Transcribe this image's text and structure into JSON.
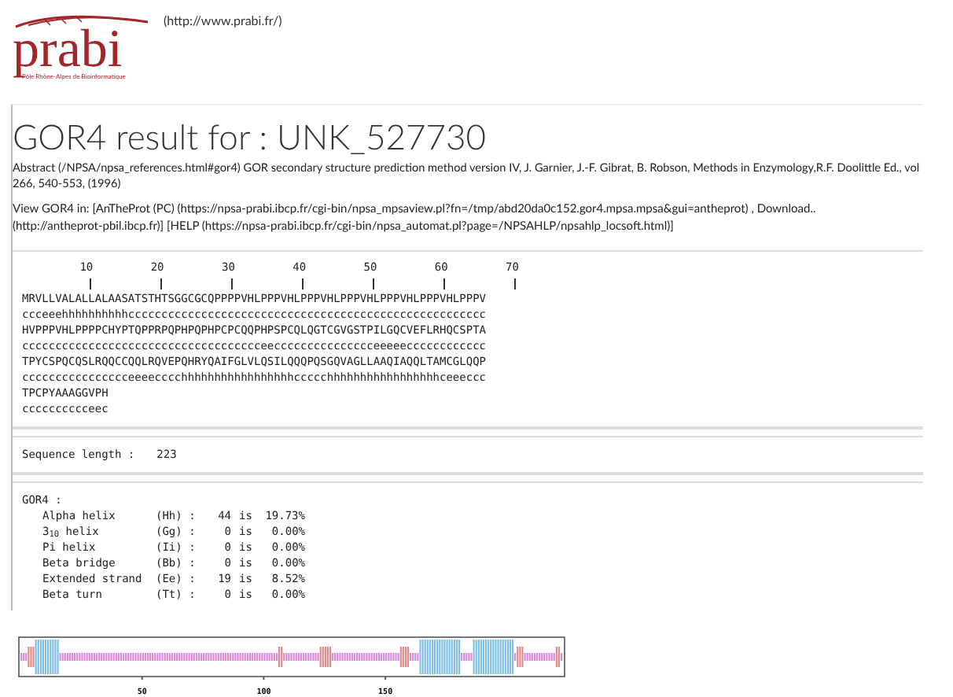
{
  "header": {
    "logo": {
      "name": "prabi",
      "tagline": "Pôle Rhône-Alpes de Bioinformatique"
    },
    "link": "(http://www.prabi.fr/)"
  },
  "title": "GOR4 result for : UNK_527730",
  "abstract": [
    "Abstract (/NPSA/npsa_references.html#gor4) GOR secondary structure prediction method version IV, J. Garnier, J.-F. Gibrat, B. Robson, Methods in Enzymology,R.F. Doolittle Ed., vol",
    "266, 540-553, (1996)"
  ],
  "view_links": "View GOR4 in: [AnTheProt (PC) (https://npsa-prabi.ibcp.fr/cgi-bin/npsa_mpsaview.pl?fn=/tmp/abd20da0c152.gor4.mpsa.mpsa&gui=antheprot) , Download.. (http://antheprot-pbil.ibcp.fr)] [HELP (https://npsa-prabi.ibcp.fr/cgi-bin/npsa_automat.pl?page=/NPSAHLP/npsahlp_locsoft.html)]",
  "ruler": [
    "10",
    "20",
    "30",
    "40",
    "50",
    "60",
    "70"
  ],
  "alignment": [
    {
      "sequence": "MRVLLVALALLALAASATSTHTSGGCGCQPPPPVHLPPPVHLPPPVHLPPPVHLPPPVHLPPPVHLPPPV",
      "structure": "ccceeehhhhhhhhhhcccccccccccccccccccccccccccccccccccccccccccccccccccccc"
    },
    {
      "sequence": "HVPPPVHLPPPPCHYPTQPPRPQPHPQPHPCPCQQPHPSPCQLQGTCGVGSTPILGQCVEFLRHQCSPTA",
      "structure": "cccccccccccccccccccccccccccccccccccceeccccccccccccccceeeeecccccccccccc"
    },
    {
      "sequence": "TPYCSPQCQSLRQQCCQQLRQVEPQHRYQAIFGLVLQSILQQQPQSGQVAGLLAAQIAQQLTAMCGLQQP",
      "structure": "cccccccccccccccceeeecccchhhhhhhhhhhhhhhhhccccchhhhhhhhhhhhhhhhhceeeccc"
    },
    {
      "sequence": "TPCPYAAAGGVPH",
      "structure": "cccccccccceec"
    }
  ],
  "sequence_length": {
    "label": "Sequence length :",
    "value": "223"
  },
  "gor4": {
    "label": "GOR4 :",
    "rows": [
      {
        "name": "Alpha helix",
        "code": "(Hh) :",
        "count": "44",
        "is": "is",
        "percent": "19.73%"
      },
      {
        "name": "3$_{10}$ helix",
        "code": "(Gg) :",
        "count": "0",
        "is": "is",
        "percent": "0.00%"
      },
      {
        "name": "Pi helix",
        "code": "(Ii) :",
        "count": "0",
        "is": "is",
        "percent": "0.00%"
      },
      {
        "name": "Beta bridge",
        "code": "(Bb) :",
        "count": "0",
        "is": "is",
        "percent": "0.00%"
      },
      {
        "name": "Extended strand",
        "code": "(Ee) :",
        "count": "19",
        "is": "is",
        "percent": "8.52%"
      },
      {
        "name": "Beta turn",
        "code": "(Tt) :",
        "count": "0",
        "is": "is",
        "percent": "0.00%"
      }
    ]
  },
  "plot": {
    "ticks": [
      "50",
      "100",
      "150"
    ]
  }
}
